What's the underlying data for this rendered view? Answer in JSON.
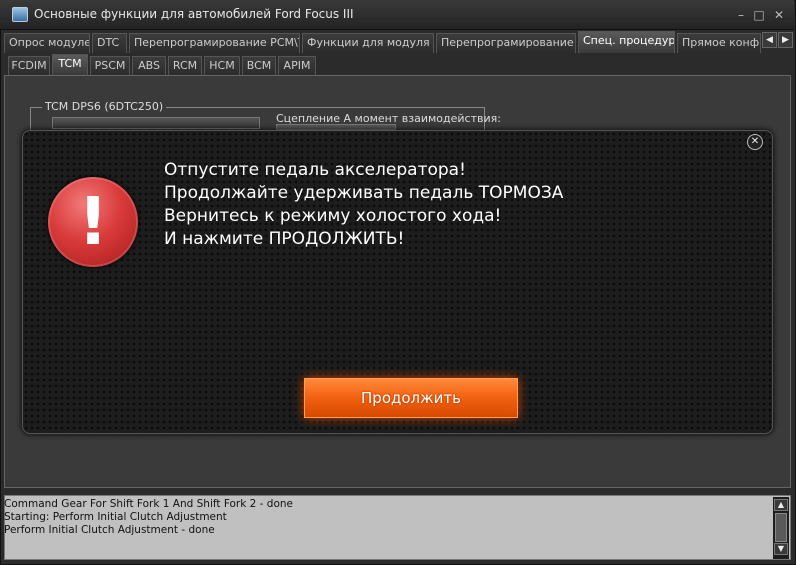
{
  "window": {
    "title": "Основные функции для автомобилей Ford Focus III",
    "minimize_glyph": "–",
    "maximize_glyph": "□",
    "close_glyph": "✕"
  },
  "tabs_main": [
    {
      "label": "Опрос модулей",
      "active": false
    },
    {
      "label": "DTC",
      "active": false
    },
    {
      "label": "Перепрограмирование PCM\\TCM",
      "active": false
    },
    {
      "label": "Функции для модуля IPC",
      "active": false
    },
    {
      "label": "Перепрограмирование ABS",
      "active": false
    },
    {
      "label": "Спец. процедуры",
      "active": true
    },
    {
      "label": "Прямое конфигу",
      "active": false
    }
  ],
  "tab_scroll": {
    "left": "◀",
    "right": "▶"
  },
  "tabs_modules": [
    {
      "label": "FCDIM",
      "active": false
    },
    {
      "label": "TCM",
      "active": true
    },
    {
      "label": "PSCM",
      "active": false
    },
    {
      "label": "ABS",
      "active": false
    },
    {
      "label": "RCM",
      "active": false
    },
    {
      "label": "HCM",
      "active": false
    },
    {
      "label": "BCM",
      "active": false
    },
    {
      "label": "APIM",
      "active": false
    }
  ],
  "panel": {
    "group_title": "TCM DPS6 (6DTC250)",
    "clutch_label": "Сцепление A момент взаимодействия:"
  },
  "dialog": {
    "close_glyph": "✕",
    "icon": "exclamation-icon",
    "icon_glyph": "!",
    "lines": [
      "Отпустите педаль акселератора!",
      "Продолжайте удерживать педаль ТОРМОЗА",
      "Вернитесь к режиму холостого хода!",
      "И нажмите ПРОДОЛЖИТЬ!"
    ],
    "continue_label": "Продолжить"
  },
  "log": {
    "lines": [
      "Command Gear For Shift Fork 1 And Shift Fork 2 - done",
      "Starting: Perform Initial Clutch Adjustment",
      "Perform Initial Clutch Adjustment - done"
    ],
    "scroll_up": "▲",
    "scroll_down": "▼"
  },
  "colors": {
    "accent_button": "#f26010",
    "warning_icon": "#d93a3a",
    "log_background": "#c0c0c0"
  }
}
